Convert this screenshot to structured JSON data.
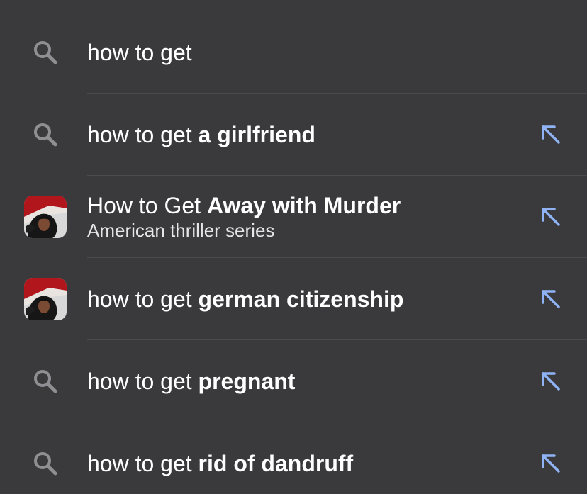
{
  "search": {
    "query": "how to get"
  },
  "suggestions": [
    {
      "prefix": "how to get ",
      "completion": "a girlfriend",
      "subtitle": "",
      "icon": "search-icon"
    },
    {
      "prefix": "How to Get ",
      "completion": "Away with Murder",
      "subtitle": "American thriller series",
      "icon": "show-thumbnail"
    },
    {
      "prefix": "how to get ",
      "completion": "german citizenship",
      "subtitle": "",
      "icon": "show-thumbnail"
    },
    {
      "prefix": "how to get ",
      "completion": "pregnant",
      "subtitle": "",
      "icon": "search-icon"
    },
    {
      "prefix": "how to get ",
      "completion": "rid of dandruff",
      "subtitle": "",
      "icon": "search-icon"
    }
  ],
  "colors": {
    "background": "#3a3a3c",
    "accent": "#8fb3f5",
    "icon_gray": "#8e8e93"
  }
}
